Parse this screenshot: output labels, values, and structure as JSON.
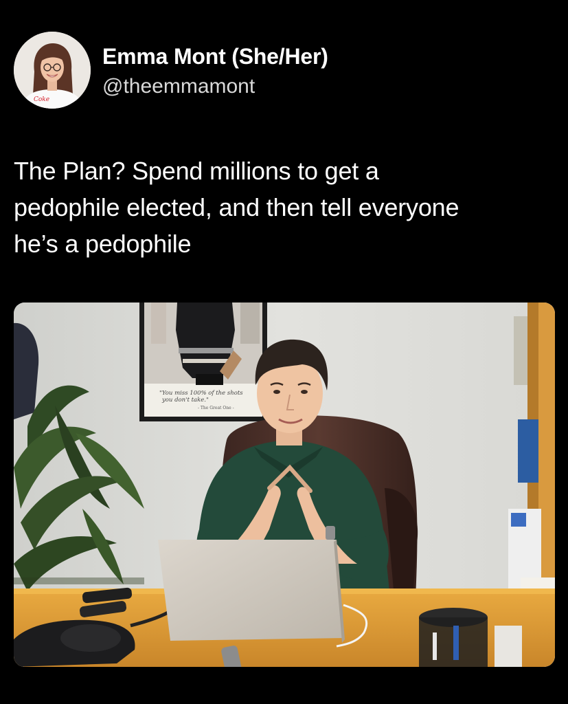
{
  "author": {
    "display_name": "Emma Mont (She/Her)",
    "handle": "@theemmamont",
    "avatar_icon": "profile-photo-avatar",
    "avatar_shirt_text": "Coke"
  },
  "tweet": {
    "lines": [
      "The Plan? Spend millions to get a",
      "pedophile elected, and then tell everyone",
      "he’s a pedophile"
    ]
  },
  "media": {
    "icon": "office-photo",
    "poster_quote_line1": "\"You miss 100% of the shots",
    "poster_quote_line2": "you don't take.\"",
    "poster_attribution": "- The Great One -"
  },
  "colors": {
    "background": "#000000",
    "text_primary": "#ffffff",
    "text_secondary": "#d9d9d9"
  }
}
